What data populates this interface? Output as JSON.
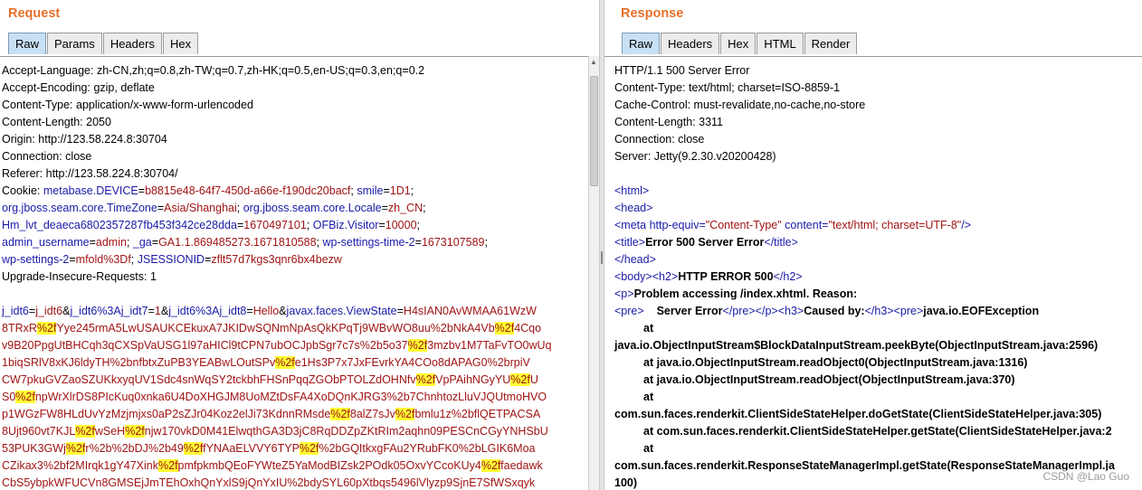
{
  "request": {
    "title": "Request",
    "tabs": [
      "Raw",
      "Params",
      "Headers",
      "Hex"
    ],
    "active_tab": "Raw",
    "headers": {
      "accept_language": "Accept-Language: zh-CN,zh;q=0.8,zh-TW;q=0.7,zh-HK;q=0.5,en-US;q=0.3,en;q=0.2",
      "accept_encoding": "Accept-Encoding: gzip, deflate",
      "content_type": "Content-Type: application/x-www-form-urlencoded",
      "content_length": "Content-Length: 2050",
      "origin": "Origin: http://123.58.224.8:30704",
      "connection": "Connection: close",
      "referer": "Referer: http://123.58.224.8:30704/",
      "upgrade": "Upgrade-Insecure-Requests: 1"
    },
    "cookie": {
      "label": "Cookie: ",
      "c1_name": "metabase.DEVICE",
      "c1_val": "b8815e48-64f7-450d-a66e-f190dc20bacf",
      "c2_name": "smile",
      "c2_val": "1D1",
      "c3_name": "org.jboss.seam.core.TimeZone",
      "c3_val": "Asia/Shanghai",
      "c4_name": "org.jboss.seam.core.Locale",
      "c4_val": "zh_CN",
      "c5_name": "Hm_lvt_deaeca6802357287fb453f342ce28dda",
      "c5_val": "1670497101",
      "c6_name": "OFBiz.Visitor",
      "c6_val": "10000",
      "c7_name": "admin_username",
      "c7_val": "admin",
      "c8_name": "_ga",
      "c8_val": "GA1.1.869485273.1671810588",
      "c9_name": "wp-settings-time-2",
      "c9_val": "1673107589",
      "c10_name": "wp-settings-2",
      "c10_val": "mfold%3Df",
      "c11_name": "JSESSIONID",
      "c11_val": "zflt57d7kgs3qnr6bx4bezw"
    },
    "body": {
      "p1_name": "j_idt6",
      "p1_val": "j_idt6",
      "p2_name": "j_idt6%3Aj_idt7",
      "p2_val": "1",
      "p3_name": "j_idt6%3Aj_idt8",
      "p3_val": "Hello",
      "p4_name": "javax.faces.ViewState",
      "l1": "H4sIAN0AvWMAA61WzW",
      "l2": [
        "8TRxR",
        "%2f",
        "Yye245rmA5LwUSAUKCEkuxA7JKIDwSQNmNpAsQkKPqTj9WBvWO8uu%2bNkA4Vb",
        "%2f",
        "4Cqo"
      ],
      "l3": [
        "v9B20PpgUtBHCqh3qCXSpVaUSG1l97aHICl9tCPN7ubOCJpbSgr7c7s%2b5o37",
        "%2f",
        "3mzbv1M7TaFvTO0wUq"
      ],
      "l4": [
        "1biqSRlV8xKJ6ldyTH%2bnfbtxZuPB3YEABwLOutSPv",
        "%2f",
        "e1Hs3P7x7JxFEvrkYA4COo8dAPAG0%2brpiV"
      ],
      "l5": [
        "CW7pkuGVZaoSZUKkxyqUV1Sdc4snWqSY2tckbhFHSnPqqZGObPTOLZdOHNfv",
        "%2f",
        "VpPAihNGyYU",
        "%2f",
        "U"
      ],
      "l6": [
        "S0",
        "%2f",
        "npWrXlrDS8PIcKuq0xnka6U4DoXHGJM8UoMZtDsFA4XoDQnKJRG3%2b7ChnhtozLluVJQUtmoHVO"
      ],
      "l7": [
        "p1WGzFW8HLdUvYzMzjmjxs0aP2sZJr04Koz2elJi73KdnnRMsde",
        "%2f",
        "8alZ7sJv",
        "%2f",
        "bmlu1z%2bflQETPACSA"
      ],
      "l8": [
        "8Ujt960vt7KJL",
        "%2f",
        "wSeH",
        "%2f",
        "njw170vkD0M41ElwqthGA3D3jC8RqDDZpZKtRIm2aqhn09PESCnCGyYNHSbU"
      ],
      "l9": [
        "53PUK3GWj",
        "%2f",
        "r%2b%2bDJ%2b49",
        "%2f",
        "fYNAaELVVY6TYP",
        "%2f",
        "%2bGQItkxgFAu2YRubFK0%2bLGIK6Moa"
      ],
      "l10": [
        "CZikax3%2bf2MIrqk1gY47Xink",
        "%2f",
        "pmfpkmbQEoFYWteZ5YaModBIZsk2POdk05OxvYCcoKUy4",
        "%2f",
        "faedawk"
      ],
      "l11": "CbS5ybpkWFUCVn8GMSEjJmTEhOxhQnYxlS9jQnYxIU%2bdySYL60pXtbqs5496lVlyzp9SjnE7SfWSxqyk"
    }
  },
  "response": {
    "title": "Response",
    "tabs": [
      "Raw",
      "Headers",
      "Hex",
      "HTML",
      "Render"
    ],
    "active_tab": "Raw",
    "headers": [
      "HTTP/1.1 500 Server Error",
      "Content-Type: text/html; charset=ISO-8859-1",
      "Cache-Control: must-revalidate,no-cache,no-store",
      "Content-Length: 3311",
      "Connection: close",
      "Server: Jetty(9.2.30.v20200428)"
    ],
    "html": {
      "html_open": "<html>",
      "head_open": "<head>",
      "meta_tag": "<meta ",
      "meta_attr1": "http-equiv=",
      "meta_val1": "\"Content-Type\"",
      "meta_attr2": " content=",
      "meta_val2": "\"text/html; charset=UTF-8\"",
      "meta_close": "/>",
      "title_open": "<title>",
      "title_text": "Error 500 Server Error",
      "title_close": "</title>",
      "head_close": "</head>",
      "body_open": "<body>",
      "h2_open": "<h2>",
      "h2_text": "HTTP ERROR 500",
      "h2_close": "</h2>",
      "p_open": "<p>",
      "p_text": "Problem accessing /index.xhtml. Reason:",
      "pre_open": "<pre>",
      "pre_text": "    Server Error",
      "pre_close": "</pre>",
      "p_close": "</p>",
      "h3_open": "<h3>",
      "h3_text": "Caused by:",
      "h3_close": "</h3>",
      "pre2_open": "<pre>",
      "exception": "java.io.EOFException",
      "at": "at",
      "st1": "java.io.ObjectInputStream$BlockDataInputStream.peekByte(ObjectInputStream.java:2596)",
      "st2": "at java.io.ObjectInputStream.readObject0(ObjectInputStream.java:1316)",
      "st3": "at java.io.ObjectInputStream.readObject(ObjectInputStream.java:370)",
      "st4": "com.sun.faces.renderkit.ClientSideStateHelper.doGetState(ClientSideStateHelper.java:305)",
      "st5": "at com.sun.faces.renderkit.ClientSideStateHelper.getState(ClientSideStateHelper.java:2",
      "st6": "com.sun.faces.renderkit.ResponseStateManagerImpl.getState(ResponseStateManagerImpl.ja",
      "st7": "100)"
    }
  },
  "watermark": "CSDN @Lao Guo"
}
